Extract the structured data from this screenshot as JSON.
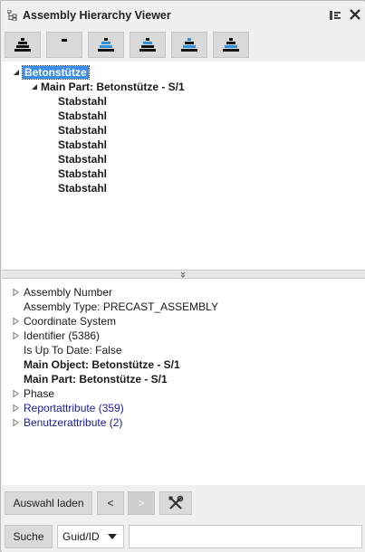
{
  "window": {
    "title": "Assembly Hierarchy Viewer"
  },
  "toolbar": {
    "buttons": [
      {
        "icon": "assembly-tree-icon"
      },
      {
        "icon": "collapse-icon"
      },
      {
        "icon": "assembly-blue-icon"
      },
      {
        "icon": "assembly-select-icon"
      },
      {
        "icon": "assembly-blue-2-icon"
      },
      {
        "icon": "assembly-select-2-icon"
      }
    ]
  },
  "tree": {
    "root": "Betonstütze",
    "main_part": "Main Part: Betonstütze - S/1",
    "children": [
      "Stabstahl",
      "Stabstahl",
      "Stabstahl",
      "Stabstahl",
      "Stabstahl",
      "Stabstahl",
      "Stabstahl"
    ]
  },
  "properties": {
    "assembly_number": "Assembly Number",
    "assembly_type": "Assembly Type: PRECAST_ASSEMBLY",
    "coordinate_system": "Coordinate System",
    "identifier": "Identifier (5386)",
    "up_to_date": "Is Up To Date: False",
    "main_object": "Main Object: Betonstütze - S/1",
    "main_part": "Main Part: Betonstütze - S/1",
    "phase": "Phase",
    "report_attributes": "Reportattribute (359)",
    "user_attributes": "Benutzerattribute (2)"
  },
  "footer": {
    "load_selection": "Auswahl laden",
    "prev": "<",
    "next": ">",
    "search_button": "Suche",
    "search_mode": "Guid/ID",
    "search_value": ""
  },
  "colors": {
    "selection": "#3d8ee8",
    "link": "#1a1aa6",
    "accent_blue": "#2f8fd8"
  }
}
